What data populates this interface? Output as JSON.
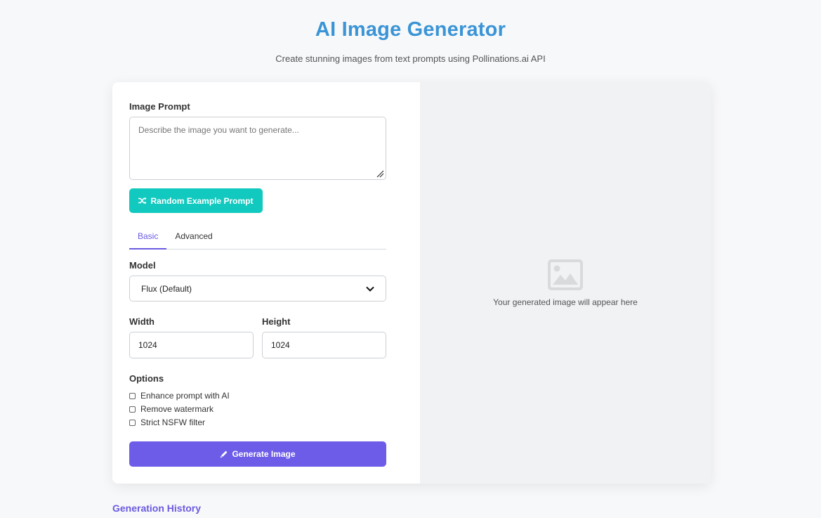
{
  "header": {
    "title": "AI Image Generator",
    "subtitle": "Create stunning images from text prompts using Pollinations.ai API"
  },
  "form": {
    "prompt_label": "Image Prompt",
    "prompt_placeholder": "Describe the image you want to generate...",
    "random_button_label": "Random Example Prompt",
    "random_button_icon": "shuffle-icon",
    "tabs": [
      {
        "label": "Basic",
        "active": true
      },
      {
        "label": "Advanced",
        "active": false
      }
    ],
    "model_label": "Model",
    "model_selected": "Flux (Default)",
    "width_label": "Width",
    "width_value": "1024",
    "height_label": "Height",
    "height_value": "1024",
    "options_label": "Options",
    "options": [
      {
        "label": "Enhance prompt with AI",
        "checked": false
      },
      {
        "label": "Remove watermark",
        "checked": false
      },
      {
        "label": "Strict NSFW filter",
        "checked": false
      }
    ],
    "generate_button_label": "Generate Image",
    "generate_button_icon": "pencil-icon"
  },
  "preview": {
    "icon": "image-icon",
    "placeholder_text": "Your generated image will appear here"
  },
  "history": {
    "title": "Generation History"
  },
  "colors": {
    "title": "#3a94d6",
    "accent": "#6d5ce7",
    "random_button": "#12c9bf",
    "preview_bg": "#f1f2f4"
  }
}
